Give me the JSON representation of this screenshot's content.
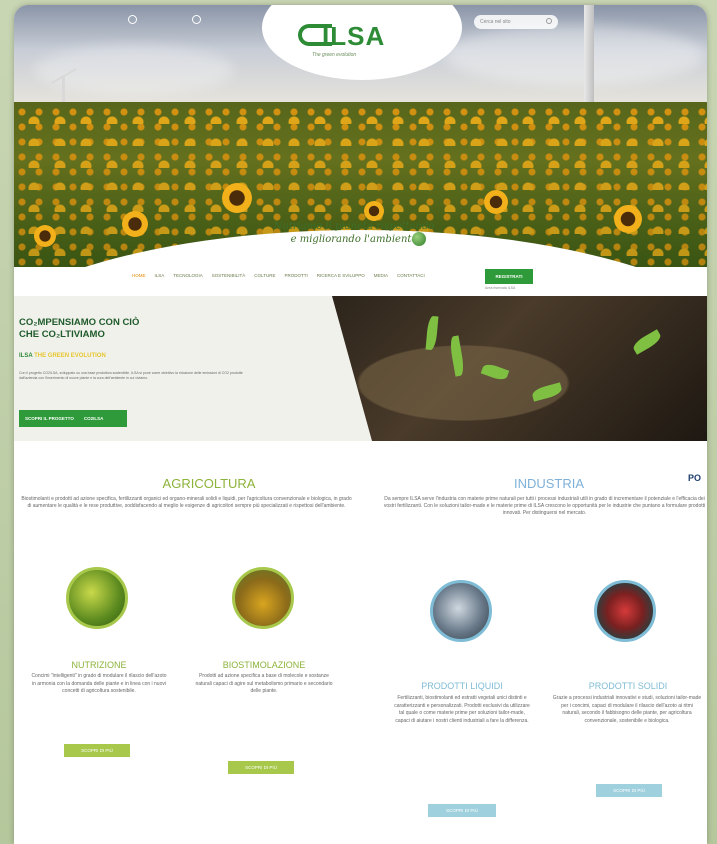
{
  "header": {
    "topbar_left": "",
    "topbar_mid": "",
    "search_placeholder": "Cerca nel sito",
    "logo_text": "ILSA",
    "logo_sub": "The green evolution"
  },
  "hero": {
    "tagline_line1": "Nutriamo il pianeta rispettando",
    "tagline_line2": "e migliorando l'ambiente"
  },
  "nav": {
    "items": [
      "HOME",
      "ILSA",
      "TECNOLOGIA",
      "SOSTENIBILITÀ",
      "COLTURE",
      "PRODOTTI",
      "RICERCA E SVILUPPO",
      "MEDIA",
      "CONTATTACI"
    ],
    "register_label": "REGISTRATI",
    "register_sub": "Area riservata ILSA"
  },
  "co2": {
    "title_line1": "CO₂MPENSIAMO CON CIÒ",
    "title_line2": "CHE CO₂LTIVIAMO",
    "sub_brand": "ILSA",
    "sub_accent": "THE GREEN EVOLUTION",
    "text": "Con il progetto CO2ILSA, sviluppato su una base produttiva sostenibile, ILSA si pone come obiettivo la riduzione delle emissioni di CO2 prodotte dall'azienda con l'inserimento di nuove piante e la cura dell'ambiente in cui viviamo.",
    "button_label": "SCOPRI IL PROGETTO",
    "button_tag": "CO2ILSA"
  },
  "agricoltura": {
    "title": "AGRICOLTURA",
    "text": "Biostimolanti e prodotti ad azione specifica, fertilizzanti organici ed organo-minerali solidi e liquidi, per l'agricoltura convenzionale e biologica, in grado di aumentare le qualità e le rese produttive, soddisfacendo al meglio le esigenze di agricoltori sempre più specializzati e rispettosi dell'ambiente.",
    "nutrizione": {
      "title": "NUTRIZIONE",
      "text": "Concimi \"intelligenti\" in grado di modulare il rilascio dell'azoto in armonia con la domanda delle piante e in linea con i nuovi concetti di agricoltura sostenibile.",
      "button": "SCOPRI DI PIÙ"
    },
    "biostimolazione": {
      "title": "BIOSTIMOLAZIONE",
      "text": "Prodotti ad azione specifica a base di molecole e sostanze naturali capaci di agire sul metabolismo primario e secondario delle piante.",
      "button": "SCOPRI DI PIÙ"
    }
  },
  "industria": {
    "title": "INDUSTRIA",
    "text": "Da sempre ILSA serve l'industria con materie prime naturali per tutti i processi industriali utili in grado di incrementare il potenziale e l'efficacia dei vostri fertilizzanti. Con le soluzioni tailor-made e le materie prime di ILSA crescono le opportunità per le industrie che puntano a formulare prodotti innovati. Per distinguersi nel mercato.",
    "liquidi": {
      "title": "PRODOTTI LIQUIDI",
      "text": "Fertilizzanti, biostimolanti ed estratti vegetali unici distinti e caratterizzanti e personalizzati. Prodotti esclusivi da utilizzare tal quale o come materie prime per soluzioni tailor-made, capaci di aiutare i nostri clienti industriali a fare la differenza.",
      "button": "SCOPRI DI PIÙ"
    },
    "solidi": {
      "title": "PRODOTTI SOLIDI",
      "text": "Grazie a processi industriali innovativi e studi, soluzioni tailor-made per i concimi, capaci di modulare il rilascio dell'azoto ai ritmi naturali, secondo il fabbisogno delle piante, per agricoltura convenzionale, sostenibile e biologica.",
      "button": "SCOPRI DI PIÙ"
    }
  },
  "partial_badge": "PO"
}
